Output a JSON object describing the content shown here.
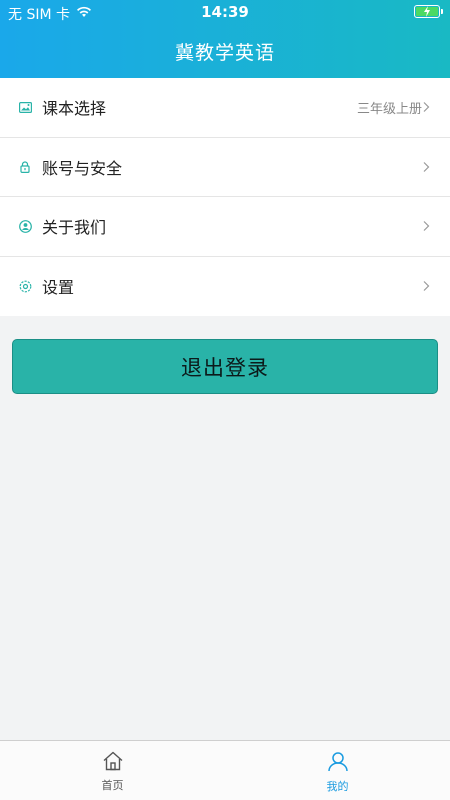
{
  "status_bar": {
    "carrier": "无 SIM 卡",
    "time": "14:39"
  },
  "header": {
    "title": "冀教学英语"
  },
  "menu": {
    "items": [
      {
        "label": "课本选择",
        "value": "三年级上册",
        "icon": "textbook-icon"
      },
      {
        "label": "账号与安全",
        "value": "",
        "icon": "lock-icon"
      },
      {
        "label": "关于我们",
        "value": "",
        "icon": "user-circle-icon"
      },
      {
        "label": "设置",
        "value": "",
        "icon": "settings-icon"
      }
    ]
  },
  "logout": {
    "label": "退出登录"
  },
  "tabbar": {
    "tabs": [
      {
        "label": "首页",
        "icon": "home-icon",
        "active": false
      },
      {
        "label": "我的",
        "icon": "person-icon",
        "active": true
      }
    ]
  },
  "colors": {
    "header_gradient_start": "#1aa8ea",
    "header_gradient_end": "#19b9c4",
    "accent": "#29b3a8",
    "active_tab": "#1a9be0"
  }
}
